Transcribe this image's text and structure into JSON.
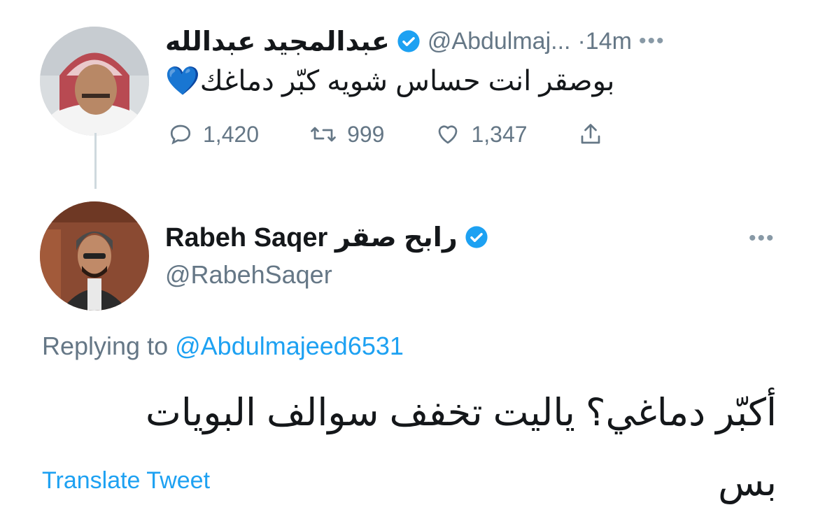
{
  "tweet1": {
    "display_name": "عبدالمجيد عبدالله",
    "handle": "@Abdulmaj...",
    "time": "·14m",
    "text": "بوصقر انت حساس شويه كبّر دماغك💙",
    "replies": "1,420",
    "retweets": "999",
    "likes": "1,347"
  },
  "tweet2": {
    "display_name": "Rabeh Saqer رابح صقر",
    "handle": "@RabehSaqer",
    "replying_label": "Replying to",
    "replying_handle": "@Abdulmajeed6531",
    "text_line1": "أكبّر دماغي؟ ياليت تخفف سوالف البويات",
    "text_line2": "بس",
    "translate": "Translate Tweet"
  },
  "icons": [
    "reply-icon",
    "retweet-icon",
    "like-icon",
    "share-icon",
    "verified-icon",
    "more-icon"
  ],
  "colors": {
    "verified": "#1da1f2",
    "link": "#1da1f2",
    "muted": "#657786"
  }
}
